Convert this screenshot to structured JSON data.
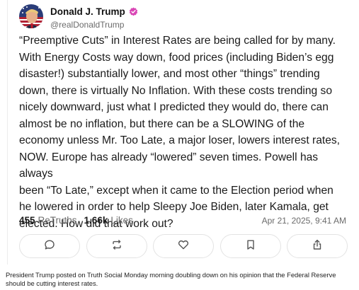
{
  "post": {
    "author": {
      "display_name": "Donald J. Trump",
      "handle": "@realDonaldTrump",
      "verified": true,
      "verified_icon": "verified-badge-icon",
      "verified_color": "#d946b5"
    },
    "body": "“Preemptive Cuts” in Interest Rates are being called for by many.\nWith Energy Costs way down, food prices (including Biden’s egg\ndisaster!) substantially lower, and most other “things” trending\ndown, there is virtually No Inflation. With these costs trending so\nnicely downward, just what I predicted they would do, there can\nalmost be no inflation, but there can be a SLOWING of the\neconomy unless Mr. Too Late, a major loser, lowers interest rates,\nNOW. Europe has already “lowered” seven times. Powell has always\nbeen “To Late,” except when it came to the Election period when\nhe lowered in order to help Sleepy Joe Biden, later Kamala, get\nelected. How did that work out?",
    "stats": {
      "retruths_count": "455",
      "retruths_label": "ReTruths",
      "likes_count": "1.66k",
      "likes_label": "Likes"
    },
    "timestamp": "Apr 21, 2025, 9:41 AM",
    "actions": [
      {
        "name": "reply",
        "icon": "comment-icon"
      },
      {
        "name": "retruth",
        "icon": "repost-icon"
      },
      {
        "name": "like",
        "icon": "heart-icon"
      },
      {
        "name": "bookmark",
        "icon": "bookmark-icon"
      },
      {
        "name": "share",
        "icon": "share-icon"
      }
    ]
  },
  "caption": "President Trump posted on Truth Social Monday morning doubling down on his opinion that the Federal Reserve should be cutting interest rates."
}
